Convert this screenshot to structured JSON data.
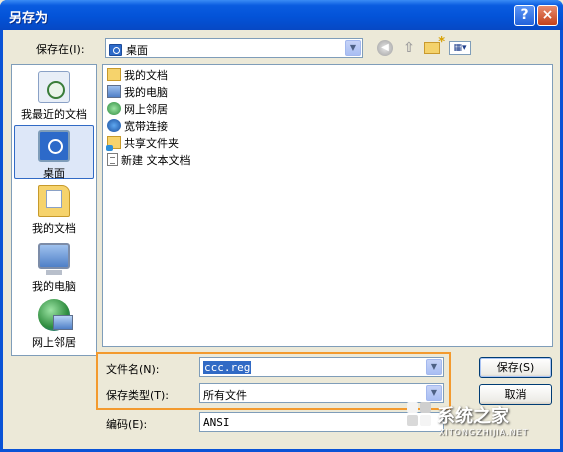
{
  "window": {
    "title": "另存为",
    "help_glyph": "?",
    "close_glyph": "×"
  },
  "toolbar": {
    "save_in_label": "保存在(I):",
    "save_in_value": "桌面",
    "back_icon": "back-arrow-icon",
    "up_icon": "up-folder-icon",
    "new_folder_icon": "new-folder-icon",
    "views_icon": "views-menu-icon",
    "views_glyph": "▦▾",
    "dropdown_glyph": "▼"
  },
  "places": [
    {
      "label": "我最近的文档",
      "icon": "recent-documents-icon"
    },
    {
      "label": "桌面",
      "icon": "desktop-icon",
      "selected": true
    },
    {
      "label": "我的文档",
      "icon": "my-documents-icon"
    },
    {
      "label": "我的电脑",
      "icon": "my-computer-icon"
    },
    {
      "label": "网上邻居",
      "icon": "network-places-icon"
    }
  ],
  "files": [
    {
      "name": "我的文档",
      "icon": "my-documents-icon"
    },
    {
      "name": "我的电脑",
      "icon": "my-computer-icon"
    },
    {
      "name": "网上邻居",
      "icon": "network-places-icon"
    },
    {
      "name": "宽带连接",
      "icon": "broadband-icon"
    },
    {
      "name": "共享文件夹",
      "icon": "shared-folder-icon"
    },
    {
      "name": "新建 文本文档",
      "icon": "text-document-icon"
    }
  ],
  "form": {
    "filename_label": "文件名(N):",
    "filename_value": "ccc.reg",
    "filetype_label": "保存类型(T):",
    "filetype_value": "所有文件",
    "encoding_label": "编码(E):",
    "encoding_value": "ANSI"
  },
  "buttons": {
    "save": "保存(S)",
    "cancel": "取消"
  },
  "watermark": {
    "text": "系统之家",
    "sub": "XITONGZHIJIA.NET"
  },
  "colors": {
    "title_bar": "#0A5CE0",
    "dialog_bg": "#ECE9D8",
    "highlight_box": "#F39A2E",
    "selection": "#316AC5"
  }
}
